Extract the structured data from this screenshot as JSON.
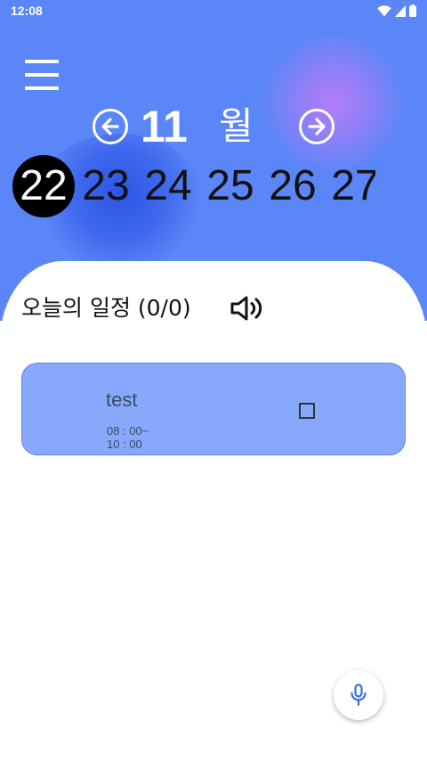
{
  "status_bar": {
    "time": "12:08",
    "icons": [
      "wifi-icon",
      "signal-icon",
      "battery-icon"
    ]
  },
  "header": {
    "menu_icon": "menu-icon",
    "month_number": "11",
    "month_unit": "월",
    "prev_icon": "arrow-left-circle-icon",
    "next_icon": "arrow-right-circle-icon",
    "dates": [
      "22",
      "23",
      "24",
      "25",
      "26",
      "27"
    ],
    "selected_date": "22"
  },
  "today": {
    "title": "오늘의 일정 (0/0)",
    "speaker_icon": "speaker-icon"
  },
  "tasks": [
    {
      "title": "test",
      "time_start": "08 : 00~",
      "time_end": "10 : 00",
      "checked": false
    }
  ],
  "fab": {
    "icon": "microphone-icon"
  },
  "colors": {
    "header_blue": "#5b86f7",
    "card_blue": "#87a8fb",
    "accent_purple": "#b57cf9",
    "mic_blue": "#3a6ee8"
  }
}
